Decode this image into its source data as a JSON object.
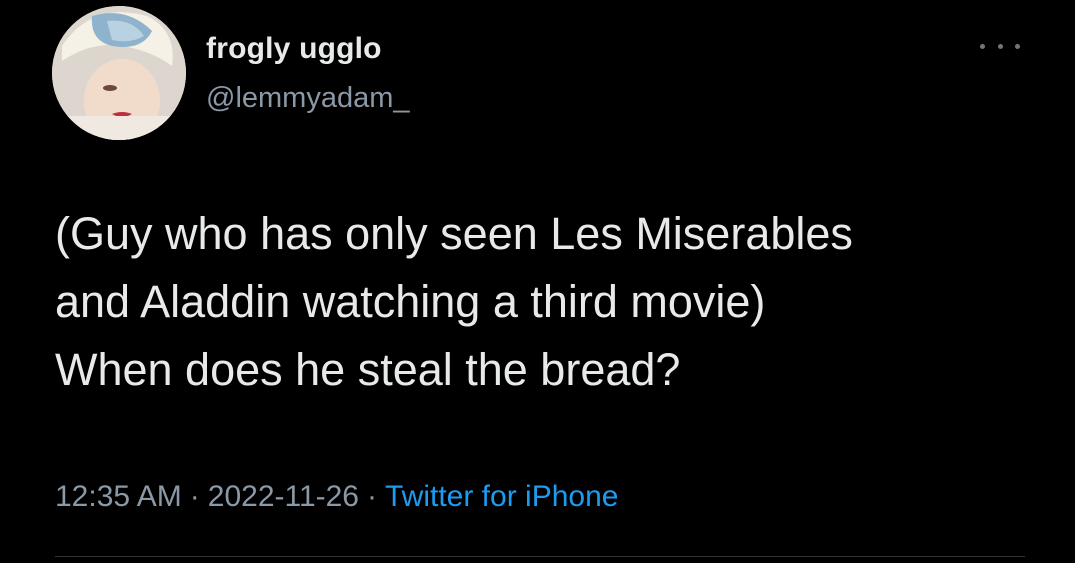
{
  "author": {
    "display_name": "frogly ugglo",
    "handle": "@lemmyadam_",
    "avatar_icon": "profile-photo"
  },
  "menu": {
    "icon": "more-horizontal-icon"
  },
  "tweet": {
    "lines": [
      "(Guy who has only seen Les Miserables",
      "and Aladdin watching a third movie)",
      "When does he steal the bread?"
    ],
    "time": "12:35 AM",
    "separator": "·",
    "date": "2022-11-26",
    "source": "Twitter for iPhone"
  },
  "colors": {
    "background": "#000000",
    "text": "#e7e9ea",
    "secondary": "#8b98a5",
    "link": "#1d9bf0"
  }
}
